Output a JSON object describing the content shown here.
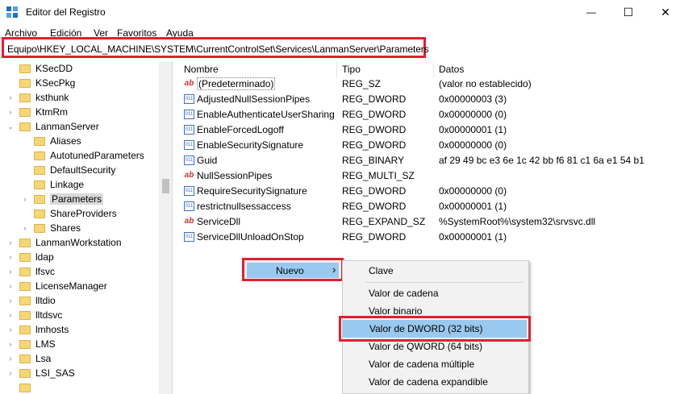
{
  "window": {
    "title": "Editor del Registro",
    "minimize": "—",
    "maximize": "☐",
    "close": "✕"
  },
  "menu": [
    "Archivo",
    "Edición",
    "Ver",
    "Favoritos",
    "Ayuda"
  ],
  "address": "Equipo\\HKEY_LOCAL_MACHINE\\SYSTEM\\CurrentControlSet\\Services\\LanmanServer\\Parameters",
  "tree": [
    {
      "label": "KSecDD",
      "chev": ""
    },
    {
      "label": "KSecPkg",
      "chev": ""
    },
    {
      "label": "ksthunk",
      "chev": ">"
    },
    {
      "label": "KtmRm",
      "chev": ">"
    },
    {
      "label": "LanmanServer",
      "chev": "v"
    },
    {
      "label": "Aliases",
      "chev": ""
    },
    {
      "label": "AutotunedParameters",
      "chev": ""
    },
    {
      "label": "DefaultSecurity",
      "chev": ""
    },
    {
      "label": "Linkage",
      "chev": ""
    },
    {
      "label": "Parameters",
      "chev": ">"
    },
    {
      "label": "ShareProviders",
      "chev": ""
    },
    {
      "label": "Shares",
      "chev": ">"
    },
    {
      "label": "LanmanWorkstation",
      "chev": ">"
    },
    {
      "label": "ldap",
      "chev": ">"
    },
    {
      "label": "lfsvc",
      "chev": ">"
    },
    {
      "label": "LicenseManager",
      "chev": ">"
    },
    {
      "label": "lltdio",
      "chev": ">"
    },
    {
      "label": "lltdsvc",
      "chev": ">"
    },
    {
      "label": "lmhosts",
      "chev": ">"
    },
    {
      "label": "LMS",
      "chev": ">"
    },
    {
      "label": "Lsa",
      "chev": ">"
    },
    {
      "label": "LSI_SAS",
      "chev": ">"
    },
    {
      "label": "",
      "chev": ""
    }
  ],
  "columns": {
    "name": "Nombre",
    "type": "Tipo",
    "data": "Datos"
  },
  "values": [
    {
      "name": "(Predeterminado)",
      "type": "REG_SZ",
      "data": "(valor no establecido)",
      "icon": "ab"
    },
    {
      "name": "AdjustedNullSessionPipes",
      "type": "REG_DWORD",
      "data": "0x00000003 (3)",
      "icon": "bin"
    },
    {
      "name": "EnableAuthenticateUserSharing",
      "type": "REG_DWORD",
      "data": "0x00000000 (0)",
      "icon": "bin"
    },
    {
      "name": "EnableForcedLogoff",
      "type": "REG_DWORD",
      "data": "0x00000001 (1)",
      "icon": "bin"
    },
    {
      "name": "EnableSecuritySignature",
      "type": "REG_DWORD",
      "data": "0x00000000 (0)",
      "icon": "bin"
    },
    {
      "name": "Guid",
      "type": "REG_BINARY",
      "data": "af 29 49 bc e3 6e 1c 42 bb f6 81 c1 6a e1 54 b1",
      "icon": "bin"
    },
    {
      "name": "NullSessionPipes",
      "type": "REG_MULTI_SZ",
      "data": "",
      "icon": "ab"
    },
    {
      "name": "RequireSecuritySignature",
      "type": "REG_DWORD",
      "data": "0x00000000 (0)",
      "icon": "bin"
    },
    {
      "name": "restrictnullsessaccess",
      "type": "REG_DWORD",
      "data": "0x00000001 (1)",
      "icon": "bin"
    },
    {
      "name": "ServiceDll",
      "type": "REG_EXPAND_SZ",
      "data": "%SystemRoot%\\system32\\srvsvc.dll",
      "icon": "ab"
    },
    {
      "name": "ServiceDllUnloadOnStop",
      "type": "REG_DWORD",
      "data": "0x00000001 (1)",
      "icon": "bin"
    }
  ],
  "context": {
    "nuevo": "Nuevo",
    "arrow": "›"
  },
  "submenu": [
    "Clave",
    "Valor de cadena",
    "Valor binario",
    "Valor de DWORD (32 bits)",
    "Valor de QWORD (64 bits)",
    "Valor de cadena múltiple",
    "Valor de cadena expandible"
  ],
  "colors": {
    "highlight": "#e0202f",
    "selection": "#99c9ef"
  }
}
